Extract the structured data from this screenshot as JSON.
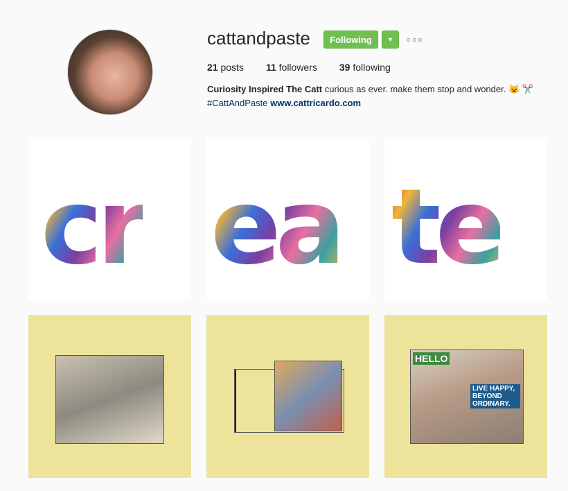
{
  "profile": {
    "username": "cattandpaste",
    "follow_label": "Following",
    "stats": {
      "posts_count": "21",
      "posts_label": "posts",
      "followers_count": "11",
      "followers_label": "followers",
      "following_count": "39",
      "following_label": "following"
    },
    "bio": {
      "name": "Curiosity Inspired The Catt",
      "text": " curious as ever. make them stop and wonder. 😺 ✂️",
      "hashtag": "#CattAndPaste",
      "website": "www.cattricardo.com"
    }
  },
  "grid": {
    "tile1_letters": "cr",
    "tile2_letters": "ea",
    "tile3_letters": "te",
    "tile6_hello": "HELLO",
    "tile6_text": "LIVE HAPPY, BEYOND ORDINARY."
  },
  "colors": {
    "accent_green": "#70c050",
    "link_blue": "#003569",
    "tile_yellow": "#ede39b"
  }
}
